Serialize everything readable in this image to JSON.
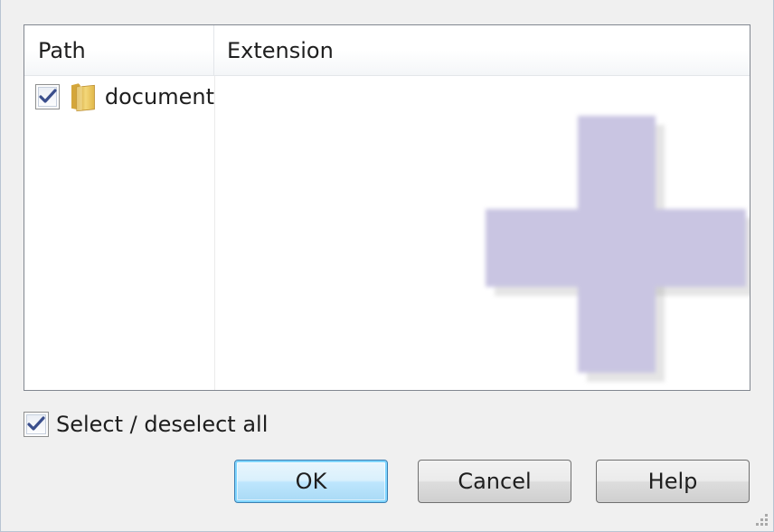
{
  "list": {
    "columns": [
      "Path",
      "Extension"
    ],
    "rows": [
      {
        "checked": true,
        "icon": "folder-icon",
        "label": "document"
      }
    ]
  },
  "select_all": {
    "checked": true,
    "label": "Select / deselect all"
  },
  "buttons": {
    "ok": "OK",
    "cancel": "Cancel",
    "help": "Help"
  },
  "colors": {
    "accent_border": "#3c7fb1",
    "plus_graphic": "#c9c5e2",
    "folder": "#e8c45a"
  }
}
